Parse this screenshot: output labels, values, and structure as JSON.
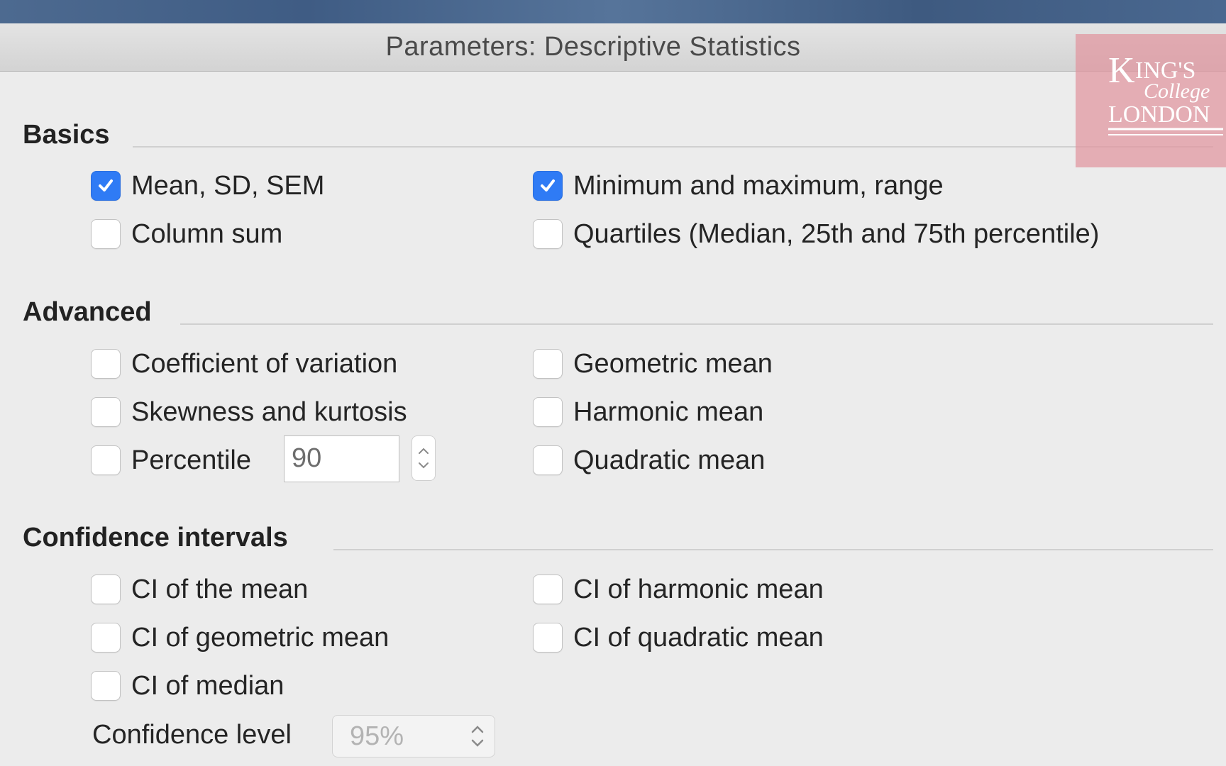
{
  "window": {
    "title": "Parameters: Descriptive Statistics"
  },
  "sections": {
    "basics": {
      "header": "Basics",
      "options": [
        {
          "label": "Mean, SD, SEM",
          "checked": true
        },
        {
          "label": "Minimum and maximum, range",
          "checked": true
        },
        {
          "label": "Column sum",
          "checked": false
        },
        {
          "label": "Quartiles (Median, 25th and 75th percentile)",
          "checked": false
        }
      ]
    },
    "advanced": {
      "header": "Advanced",
      "options": [
        {
          "label": "Coefficient of variation",
          "checked": false
        },
        {
          "label": "Geometric mean",
          "checked": false
        },
        {
          "label": "Skewness and kurtosis",
          "checked": false
        },
        {
          "label": "Harmonic mean",
          "checked": false
        },
        {
          "label": "Percentile",
          "checked": false
        },
        {
          "label": "Quadratic mean",
          "checked": false
        }
      ],
      "percentile_value": "90"
    },
    "confidence": {
      "header": "Confidence intervals",
      "options": [
        {
          "label": "CI of the mean",
          "checked": false
        },
        {
          "label": "CI of harmonic mean",
          "checked": false
        },
        {
          "label": "CI of geometric mean",
          "checked": false
        },
        {
          "label": "CI of quadratic mean",
          "checked": false
        },
        {
          "label": "CI of median",
          "checked": false
        }
      ],
      "level_label": "Confidence level",
      "level_value": "95%"
    }
  },
  "logo": {
    "line1": "KING'S",
    "line2": "College",
    "line3": "LONDON"
  },
  "colors": {
    "accent": "#2f7bf5",
    "logo_bg": "#e0949e"
  }
}
